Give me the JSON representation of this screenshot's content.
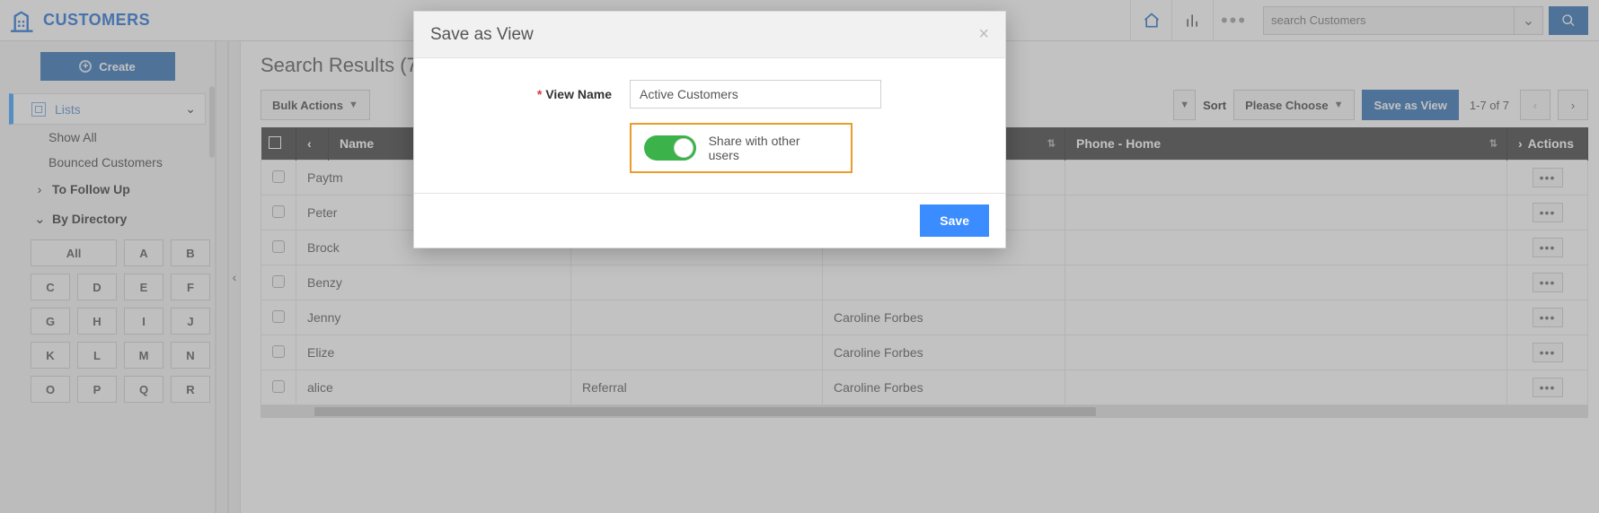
{
  "header": {
    "brand": "CUSTOMERS",
    "search_placeholder": "search Customers"
  },
  "sidebar": {
    "create_label": "Create",
    "lists_label": "Lists",
    "lists_items": [
      "Show All",
      "Bounced Customers"
    ],
    "group_followup": "To Follow Up",
    "group_directory": "By Directory",
    "directory": [
      "All",
      "A",
      "B",
      "C",
      "D",
      "E",
      "F",
      "G",
      "H",
      "I",
      "J",
      "K",
      "L",
      "M",
      "N",
      "O",
      "P",
      "Q",
      "R"
    ]
  },
  "main": {
    "heading": "Search Results (7)",
    "bulk_label": "Bulk Actions",
    "sort_label": "Sort",
    "sort_placeholder": "Please Choose",
    "save_view_label": "Save as View",
    "page_label": "1-7 of 7",
    "columns": {
      "name": "Name",
      "phone": "Phone - Home",
      "actions": "Actions",
      "col3": "",
      "col4": ""
    },
    "rows": [
      {
        "name": "Paytm",
        "c3": "",
        "c4": "",
        "phone": ""
      },
      {
        "name": "Peter",
        "c3": "",
        "c4": "",
        "phone": ""
      },
      {
        "name": "Brock",
        "c3": "",
        "c4": "",
        "phone": ""
      },
      {
        "name": "Benzy",
        "c3": "",
        "c4": "",
        "phone": ""
      },
      {
        "name": "Jenny",
        "c3": "",
        "c4": "Caroline Forbes",
        "phone": ""
      },
      {
        "name": "Elize",
        "c3": "",
        "c4": "Caroline Forbes",
        "phone": ""
      },
      {
        "name": "alice",
        "c3": "Referral",
        "c4": "Caroline Forbes",
        "phone": ""
      }
    ]
  },
  "dialog": {
    "title": "Save as View",
    "field_label": "View Name",
    "field_value": "Active Customers",
    "share_label": "Share with other users",
    "share_on": true,
    "save_label": "Save"
  }
}
